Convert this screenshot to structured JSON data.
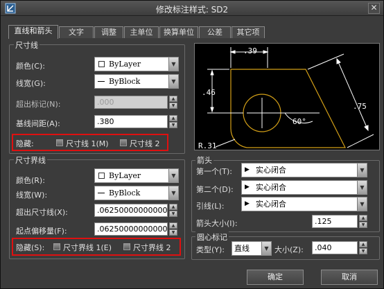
{
  "window": {
    "title": "修改标注样式: SD2",
    "close": "✕"
  },
  "tabs": [
    "直线和箭头",
    "文字",
    "调整",
    "主单位",
    "换算单位",
    "公差",
    "其它项"
  ],
  "dim_line": {
    "legend": "尺寸线",
    "color_label": "颜色(C):",
    "color_value": "ByLayer",
    "lineweight_label": "线宽(G):",
    "lineweight_value": "ByBlock",
    "extend_label": "超出标记(N):",
    "extend_value": ".000",
    "baseline_label": "基线间距(A):",
    "baseline_value": ".380",
    "suppress_label": "隐藏:",
    "suppress1": "尺寸线 1(M)",
    "suppress2": "尺寸线 2"
  },
  "ext_line": {
    "legend": "尺寸界线",
    "color_label": "颜色(R):",
    "color_value": "ByLayer",
    "lineweight_label": "线宽(W):",
    "lineweight_value": "ByBlock",
    "extend_label": "超出尺寸线(X):",
    "extend_value": ".062500000000000",
    "offset_label": "起点偏移量(F):",
    "offset_value": ".062500000000000",
    "suppress_label": "隐藏(S):",
    "suppress1": "尺寸界线 1(E)",
    "suppress2": "尺寸界线 2"
  },
  "preview": {
    "dim_top": ".39",
    "dim_left": ".46",
    "dim_right": ".75",
    "angle": "60°",
    "radius": "R.31"
  },
  "arrowheads": {
    "legend": "箭头",
    "first_label": "第一个(T):",
    "first_value": "实心闭合",
    "second_label": "第二个(D):",
    "second_value": "实心闭合",
    "leader_label": "引线(L):",
    "leader_value": "实心闭合",
    "size_label": "箭头大小(I):",
    "size_value": ".125"
  },
  "center_mark": {
    "legend": "圆心标记",
    "type_label": "类型(Y):",
    "type_value": "直线",
    "size_label": "大小(Z):",
    "size_value": ".040"
  },
  "buttons": {
    "ok": "确定",
    "cancel": "取消"
  },
  "colors": {
    "accent_red": "#e01010",
    "preview_geometry": "#d4a017",
    "preview_dims": "#ffffff"
  }
}
